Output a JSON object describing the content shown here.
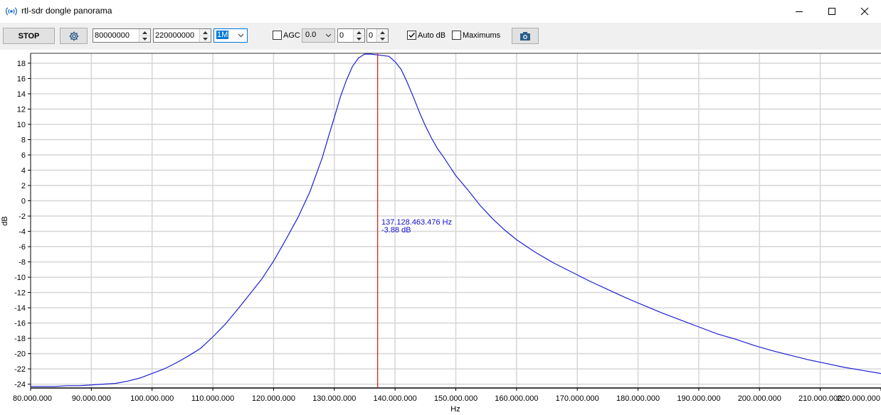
{
  "window": {
    "title": "rtl-sdr dongle panorama",
    "icon": "radio-waves-icon",
    "controls": [
      "minimize-icon",
      "maximize-icon",
      "close-icon"
    ]
  },
  "toolbar": {
    "stop_label": "STOP",
    "settings_icon": "gear-icon",
    "start_freq": "80000000",
    "end_freq": "220000000",
    "step": "1M",
    "agc_label": "AGC",
    "agc_checked": false,
    "gain": "0.0",
    "spin1": "0",
    "spin2": "0",
    "autodb_label": "Auto dB",
    "autodb_checked": true,
    "maximums_label": "Maximums",
    "maximums_checked": false,
    "snapshot_icon": "camera-icon"
  },
  "cursor": {
    "freq_label": "137.128.463.476 Hz",
    "db_label": "-3.88 dB",
    "freq": 137128463
  },
  "chart_data": {
    "type": "line",
    "xlabel": "Hz",
    "ylabel": "dB",
    "xlim": [
      80000000,
      220000000
    ],
    "ylim": [
      -24.5,
      19.3
    ],
    "grid": true,
    "line_color": "#1f1fd6",
    "cursor_color": "#e02020",
    "x_ticks": [
      "80.000.000",
      "90.000.000",
      "100.000.000",
      "110.000.000",
      "120.000.000",
      "130.000.000",
      "140.000.000",
      "150.000.000",
      "160.000.000",
      "170.000.000",
      "180.000.000",
      "190.000.000",
      "200.000.000",
      "210.000.000",
      "220.000.000"
    ],
    "y_ticks": [
      "18",
      "16",
      "14",
      "12",
      "10",
      "8",
      "6",
      "4",
      "2",
      "0",
      "-2",
      "-4",
      "-6",
      "-8",
      "-10",
      "-12",
      "-14",
      "-16",
      "-18",
      "-20",
      "-22",
      "-24"
    ],
    "series": [
      {
        "x": [
          80000000,
          82000000,
          84000000,
          86000000,
          88000000,
          90000000,
          92000000,
          94000000,
          96000000,
          98000000,
          100000000,
          102000000,
          104000000,
          106000000,
          108000000,
          110000000,
          112000000,
          114000000,
          116000000,
          118000000,
          120000000,
          122000000,
          124000000,
          126000000,
          128000000,
          129000000,
          130000000,
          131000000,
          132000000,
          133000000,
          134000000,
          135000000,
          136000000,
          137000000,
          138000000,
          139000000,
          140000000,
          141000000,
          142000000,
          143000000,
          144000000,
          145000000,
          146000000,
          147000000,
          148000000,
          150000000,
          152000000,
          154000000,
          156000000,
          158000000,
          160000000,
          163000000,
          166000000,
          169000000,
          172000000,
          175000000,
          178000000,
          181000000,
          184000000,
          187000000,
          190000000,
          193000000,
          196000000,
          199000000,
          202000000,
          205000000,
          208000000,
          211000000,
          214000000,
          217000000,
          220000000
        ],
        "y": [
          -24.3,
          -24.3,
          -24.3,
          -24.2,
          -24.2,
          -24.1,
          -24.0,
          -23.9,
          -23.6,
          -23.2,
          -22.6,
          -22.0,
          -21.2,
          -20.3,
          -19.3,
          -17.8,
          -16.2,
          -14.3,
          -12.3,
          -10.3,
          -7.9,
          -5.1,
          -2.2,
          1.2,
          5.6,
          8.3,
          10.9,
          13.6,
          15.8,
          17.6,
          18.7,
          19.2,
          19.2,
          19.1,
          19.0,
          18.9,
          18.2,
          17.2,
          15.5,
          13.6,
          11.6,
          9.8,
          8.2,
          6.8,
          5.7,
          3.3,
          1.4,
          -0.6,
          -2.3,
          -3.8,
          -5.1,
          -6.7,
          -8.1,
          -9.3,
          -10.5,
          -11.6,
          -12.7,
          -13.7,
          -14.7,
          -15.6,
          -16.5,
          -17.4,
          -18.1,
          -18.9,
          -19.6,
          -20.2,
          -20.8,
          -21.3,
          -21.8,
          -22.2,
          -22.6
        ]
      }
    ]
  }
}
